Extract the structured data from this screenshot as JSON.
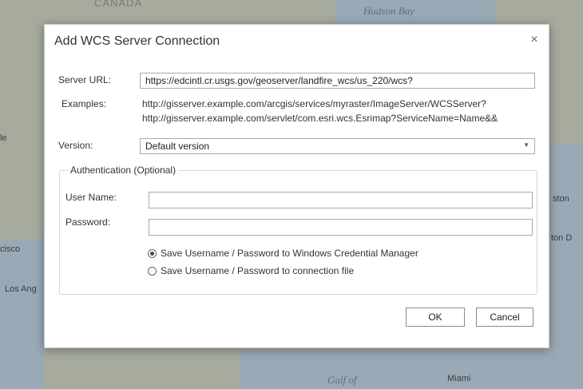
{
  "map": {
    "labels": {
      "canada": "CANADA",
      "hudson_bay": "Hudson Bay",
      "cisco": "cisco",
      "los_angeles": "Los Ang",
      "gulf": "Gulf of",
      "miami": "Miami",
      "boston": "ston",
      "boston_d": "ton D",
      "le": "le"
    }
  },
  "dialog": {
    "title": "Add WCS Server Connection",
    "close_glyph": "×",
    "server_url": {
      "label": "Server URL:",
      "value": "https://edcintl.cr.usgs.gov/geoserver/landfire_wcs/us_220/wcs?"
    },
    "examples": {
      "label": "Examples:",
      "lines": [
        "http://gisserver.example.com/arcgis/services/myraster/ImageServer/WCSServer?",
        "http://gisserver.example.com/servlet/com.esri.wcs.Esrimap?ServiceName=Name&&"
      ]
    },
    "version": {
      "label": "Version:",
      "selected": "Default version",
      "arrow_glyph": "▼"
    },
    "authentication": {
      "legend": "Authentication (Optional)",
      "user_name_label": "User Name:",
      "user_name_value": "",
      "password_label": "Password:",
      "password_value": "",
      "options": [
        {
          "label": "Save Username / Password to Windows Credential Manager",
          "checked": true
        },
        {
          "label": "Save Username / Password to connection file",
          "checked": false
        }
      ]
    },
    "buttons": {
      "ok": "OK",
      "cancel": "Cancel"
    }
  }
}
